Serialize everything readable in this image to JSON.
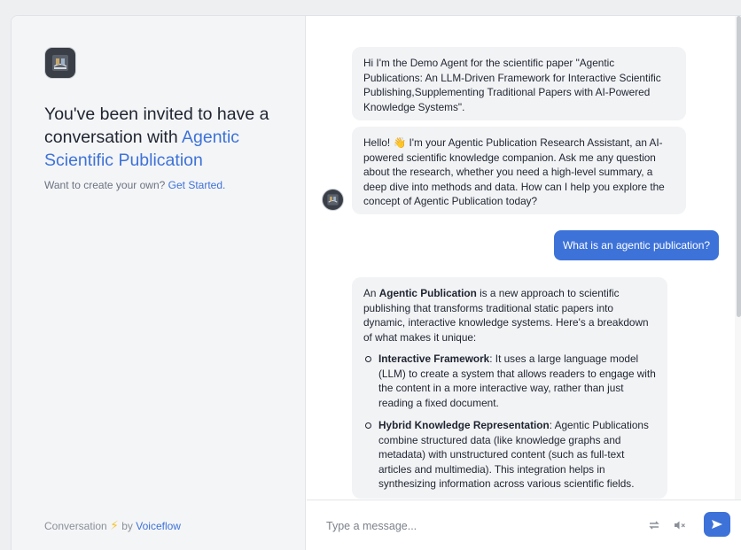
{
  "sidebar": {
    "invite_prefix": "You've been invited to have a conversation with",
    "invite_accent": "Agentic Scientific Publication",
    "create_prompt": "Want to create your own?",
    "create_link": "Get Started.",
    "footer_prefix": "Conversation",
    "footer_by": "by",
    "footer_brand": "Voiceflow",
    "logo_icon": "library-logo-icon",
    "bolt_icon": "lightning-bolt-icon"
  },
  "messages": {
    "intro": "Hi I'm the  Demo Agent for the scientific paper \"Agentic Publications: An LLM-Driven Framework for Interactive Scientific Publishing,Supplementing Traditional Papers with AI-Powered Knowledge Systems\".",
    "greeting_prefix": "Hello!",
    "greeting_emoji": "👋",
    "greeting_rest": "I'm your Agentic Publication Research Assistant, an AI-powered scientific knowledge companion. Ask me any question about the research, whether you need a high-level summary, a deep dive into methods and data. How can I help you explore the concept of Agentic Publication today?",
    "user_question": "What is an agentic publication?",
    "answer": {
      "intro_prefix": "An",
      "intro_bold": "Agentic Publication",
      "intro_rest": "is a new approach to scientific publishing that transforms traditional static papers into dynamic, interactive knowledge systems. Here's a breakdown of what makes it unique:",
      "bullets": [
        {
          "title": "Interactive Framework",
          "text": ": It uses a large language model (LLM) to create a system that allows readers to engage with the content in a more interactive way, rather than just reading a fixed document."
        },
        {
          "title": "Hybrid Knowledge Representation",
          "text": ": Agentic Publications combine structured data (like knowledge graphs and metadata) with unstructured content (such as full-text articles and multimedia). This integration helps in synthesizing information across various scientific fields."
        }
      ]
    }
  },
  "composer": {
    "placeholder": "Type a message...",
    "refresh_icon": "refresh-icon",
    "mute_icon": "speaker-mute-icon",
    "send_icon": "send-icon"
  },
  "colors": {
    "accent": "#3d72d8",
    "bubble": "#f2f3f5",
    "sidebar": "#f4f5f7"
  }
}
